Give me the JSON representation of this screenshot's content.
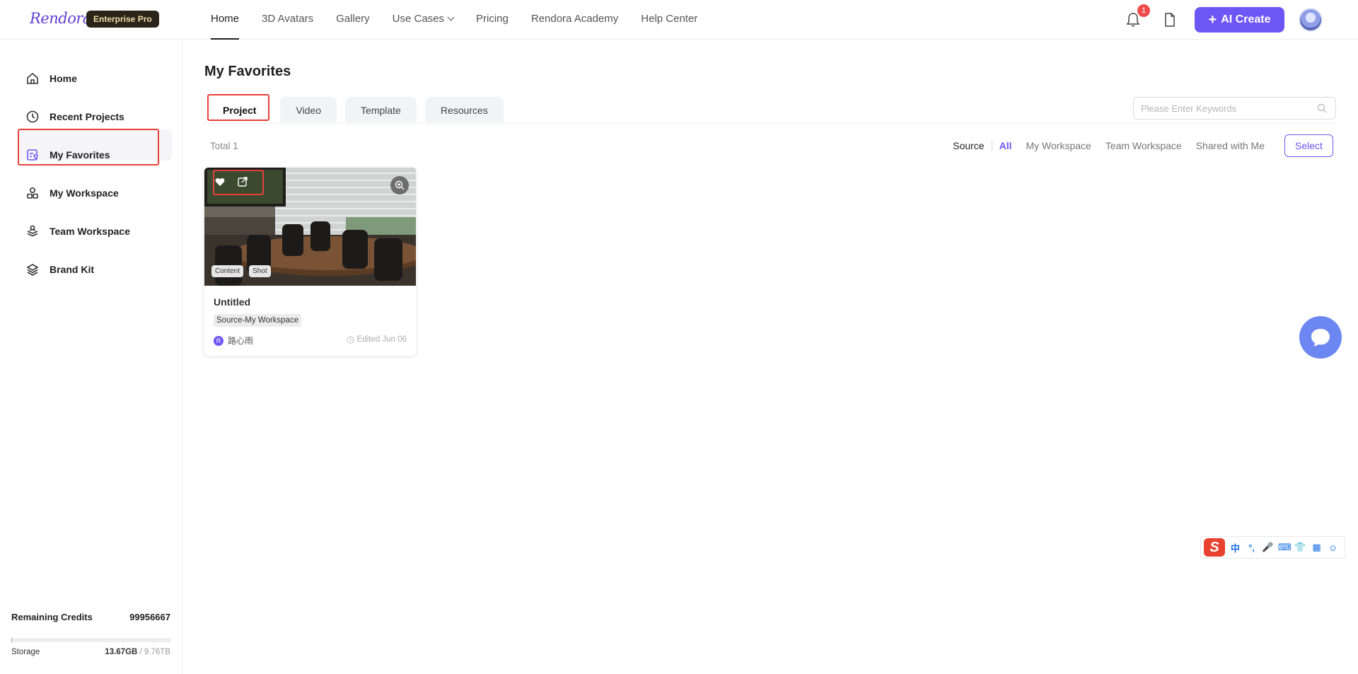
{
  "app": {
    "logo": "Rendora",
    "plan_badge": "Enterprise Pro"
  },
  "nav": {
    "items": [
      {
        "label": "Home",
        "active": true
      },
      {
        "label": "3D Avatars"
      },
      {
        "label": "Gallery"
      },
      {
        "label": "Use Cases",
        "has_dropdown": true
      },
      {
        "label": "Pricing"
      },
      {
        "label": "Rendora Academy"
      },
      {
        "label": "Help Center"
      }
    ],
    "notification_count": "1",
    "ai_create_label": "AI Create"
  },
  "sidebar": {
    "items": [
      {
        "label": "Home",
        "icon": "home-icon"
      },
      {
        "label": "Recent Projects",
        "icon": "clock-icon"
      },
      {
        "label": "My Favorites",
        "icon": "favorites-icon",
        "active": true
      },
      {
        "label": "My Workspace",
        "icon": "workspace-icon"
      },
      {
        "label": "Team Workspace",
        "icon": "team-icon"
      },
      {
        "label": "Brand Kit",
        "icon": "layers-icon"
      }
    ],
    "credits_label": "Remaining Credits",
    "credits_value": "99956667",
    "storage_label": "Storage",
    "storage_used": "13.67GB",
    "storage_sep": " / ",
    "storage_total": "9.76TB"
  },
  "main": {
    "title": "My Favorites",
    "tabs": [
      {
        "label": "Project",
        "active": true
      },
      {
        "label": "Video"
      },
      {
        "label": "Template"
      },
      {
        "label": "Resources"
      }
    ],
    "search_placeholder": "Please Enter Keywords",
    "total_label": "Total 1",
    "source_label": "Source",
    "source_options": [
      {
        "label": "All",
        "active": true
      },
      {
        "label": "My Workspace"
      },
      {
        "label": "Team Workspace"
      },
      {
        "label": "Shared with Me"
      }
    ],
    "select_label": "Select"
  },
  "cards": [
    {
      "title": "Untitled",
      "tags": [
        "Content",
        "Shot"
      ],
      "source_chip": "Source-My Workspace",
      "owner": "路心雨",
      "owner_initial": "R",
      "edited": "Edited Jun 06"
    }
  ],
  "ime": {
    "logo": "S",
    "glyphs": [
      "中",
      "°,",
      "🎤",
      "⌨",
      "👕",
      "▦",
      "☺"
    ]
  },
  "colors": {
    "accent": "#6c56f5",
    "highlight": "#e8413b",
    "chat": "#6c87f1"
  }
}
